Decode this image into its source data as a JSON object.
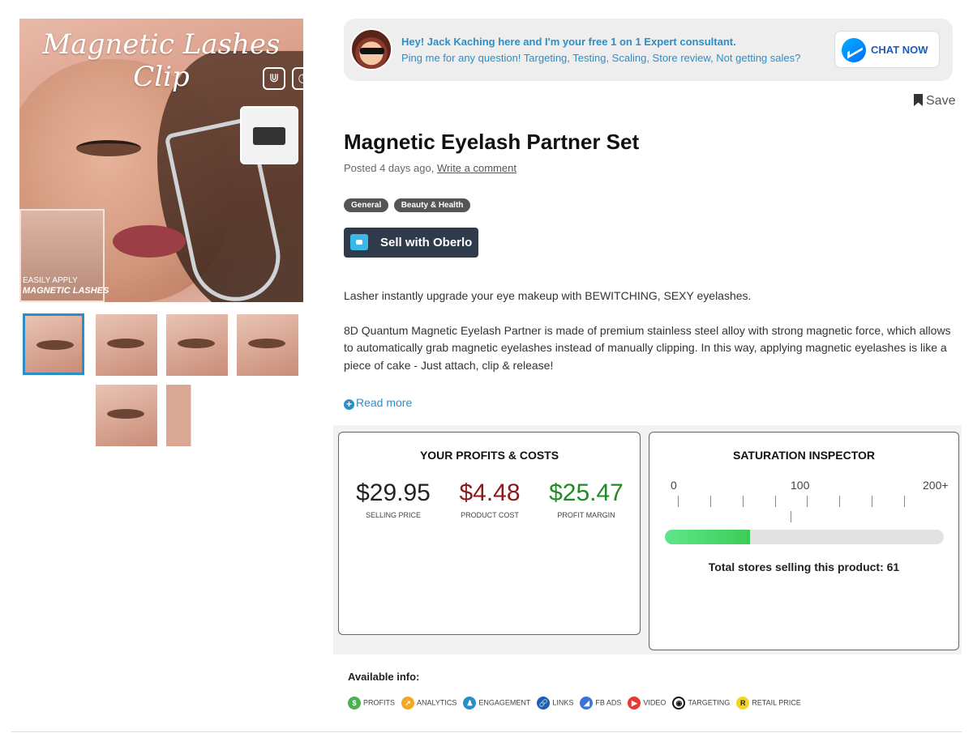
{
  "gallery": {
    "banner_text": "Magnetic Lashes Clip",
    "inset_text_small": "EASILY APPLY",
    "inset_text_big": "MAGNETIC LASHES",
    "thumbnails_count": 6
  },
  "consultant": {
    "line1": "Hey! Jack Kaching here and I'm your free 1 on 1 Expert consultant.",
    "line2": "Ping me for any question! Targeting, Testing, Scaling, Store review, Not getting sales?",
    "chat_button": "CHAT NOW",
    "chat_icon": "messenger-icon"
  },
  "save_label": "Save",
  "product": {
    "title": "Magnetic Eyelash Partner Set",
    "posted": "Posted 4 days ago,",
    "comment_link": "Write a comment",
    "tags": [
      "General",
      "Beauty & Health"
    ],
    "oberlo_button": "Sell with Oberlo",
    "description": [
      "Lasher instantly upgrade your eye makeup with BEWITCHING, SEXY eyelashes.",
      "8D Quantum Magnetic Eyelash Partner is made of premium stainless steel alloy with strong magnetic force, which allows to automatically grab magnetic eyelashes instead of manually clipping. In this way, applying magnetic eyelashes is like a piece of cake - Just attach, clip & release!"
    ],
    "read_more": "Read more"
  },
  "profits": {
    "heading": "YOUR PROFITS & COSTS",
    "selling_price": "$29.95",
    "selling_label": "SELLING PRICE",
    "product_cost": "$4.48",
    "cost_label": "PRODUCT COST",
    "profit_margin": "$25.47",
    "margin_label": "PROFIT MARGIN",
    "colors": {
      "price": "#222222",
      "cost": "#8b1a1a",
      "margin": "#1f8b24"
    }
  },
  "saturation": {
    "heading": "SATURATION INSPECTOR",
    "scale_min": "0",
    "scale_mid": "100",
    "scale_max": "200+",
    "fill_fraction": 0.305,
    "total_text": "Total stores selling this product: 61"
  },
  "available_info": {
    "title": "Available info:",
    "items": [
      {
        "label": "PROFITS",
        "color": "#4caf50",
        "glyph": "$",
        "icon": "dollar-icon"
      },
      {
        "label": "ANALYTICS",
        "color": "#f5a623",
        "glyph": "↗",
        "icon": "analytics-icon"
      },
      {
        "label": "ENGAGEMENT",
        "color": "#2a8fc9",
        "glyph": "♟",
        "icon": "engagement-icon"
      },
      {
        "label": "LINKS",
        "color": "#1a5dbb",
        "glyph": "🔗",
        "icon": "link-icon"
      },
      {
        "label": "FB ADS",
        "color": "#3b73d6",
        "glyph": "◢",
        "icon": "fb-ads-icon"
      },
      {
        "label": "VIDEO",
        "color": "#e53935",
        "glyph": "▶",
        "icon": "video-icon"
      },
      {
        "label": "TARGETING",
        "color": "#111111",
        "glyph": "◉",
        "icon": "target-icon"
      },
      {
        "label": "RETAIL PRICE",
        "color": "#f7d21e",
        "glyph": "R",
        "icon": "retail-price-icon"
      }
    ]
  }
}
